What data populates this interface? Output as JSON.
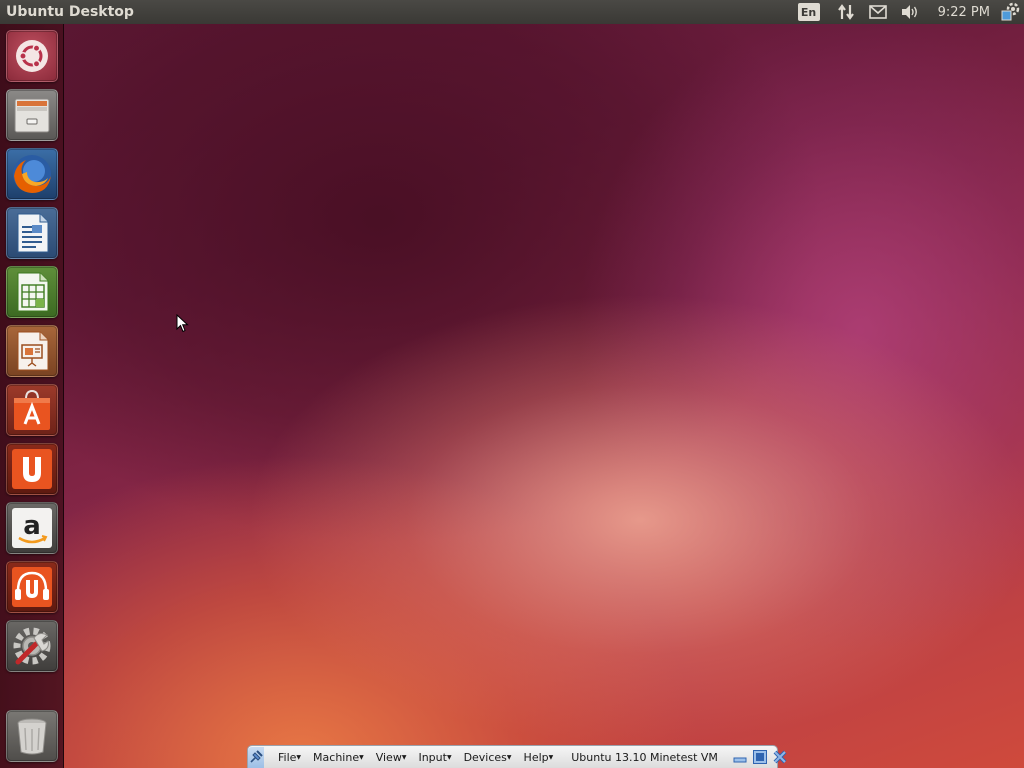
{
  "top_panel": {
    "title": "Ubuntu Desktop",
    "keyboard_layout": "En",
    "clock": "9:22 PM",
    "indicators": [
      "network-icon",
      "mail-icon",
      "volume-icon",
      "session-gear-icon"
    ]
  },
  "launcher": {
    "items": [
      {
        "name": "dash-home",
        "icon": "ubuntu-logo-icon"
      },
      {
        "name": "files",
        "icon": "file-cabinet-icon"
      },
      {
        "name": "firefox",
        "icon": "firefox-icon"
      },
      {
        "name": "libreoffice-writer",
        "icon": "writer-document-icon"
      },
      {
        "name": "libreoffice-calc",
        "icon": "calc-spreadsheet-icon"
      },
      {
        "name": "libreoffice-impress",
        "icon": "impress-presentation-icon"
      },
      {
        "name": "ubuntu-software-center",
        "icon": "shopping-bag-icon"
      },
      {
        "name": "ubuntu-one",
        "icon": "ubuntu-one-icon"
      },
      {
        "name": "amazon",
        "icon": "amazon-icon"
      },
      {
        "name": "ubuntu-one-music",
        "icon": "headphones-u-icon"
      },
      {
        "name": "system-settings",
        "icon": "settings-wrench-icon"
      },
      {
        "name": "trash",
        "icon": "trash-icon"
      }
    ]
  },
  "vm_toolbar": {
    "menus": [
      "File",
      "Machine",
      "View",
      "Input",
      "Devices",
      "Help"
    ],
    "vm_name": "Ubuntu 13.10 Minetest VM"
  },
  "colors": {
    "panel": "#3c3b37",
    "accent_orange": "#e95420",
    "wallpaper_dark": "#5a1732"
  }
}
